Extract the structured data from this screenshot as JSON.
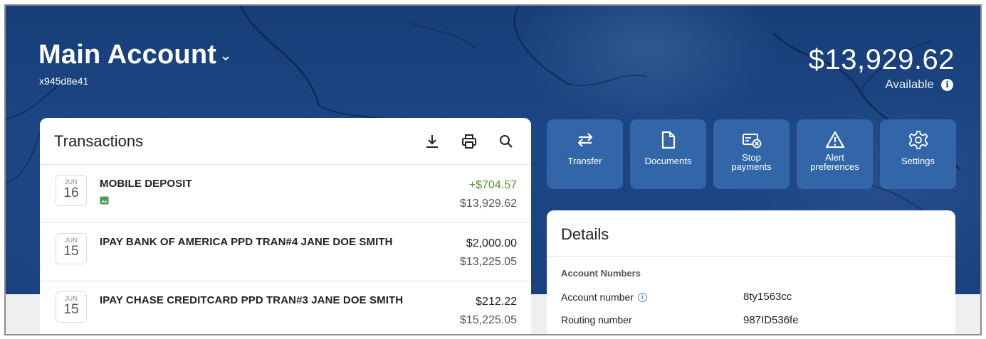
{
  "account": {
    "title": "Main Account",
    "id": "x945d8e41",
    "balance": "$13,929.62",
    "available_label": "Available"
  },
  "transactions": {
    "title": "Transactions",
    "tools": [
      "download-icon",
      "print-icon",
      "search-icon"
    ],
    "rows": [
      {
        "month": "JUN",
        "day": "16",
        "description": "MOBILE DEPOSIT",
        "amount": "+$704.57",
        "balance": "$13,929.62",
        "has_image": true
      },
      {
        "month": "JUN",
        "day": "15",
        "description": "IPAY BANK OF AMERICA PPD TRAN#4 JANE DOE SMITH",
        "amount": "$2,000.00",
        "balance": "$13,225.05",
        "has_image": false
      },
      {
        "month": "JUN",
        "day": "15",
        "description": "IPAY CHASE CREDITCARD PPD TRAN#3  JANE DOE SMITH",
        "amount": "$212.22",
        "balance": "$15,225.05",
        "has_image": false
      }
    ]
  },
  "actions": [
    {
      "label": "Transfer",
      "icon": "transfer-icon"
    },
    {
      "label": "Documents",
      "icon": "document-icon"
    },
    {
      "label": "Stop\npayments",
      "icon": "stop-payment-icon"
    },
    {
      "label": "Alert\npreferences",
      "icon": "alert-icon"
    },
    {
      "label": "Settings",
      "icon": "gear-icon"
    }
  ],
  "details": {
    "title": "Details",
    "section": "Account Numbers",
    "fields": [
      {
        "label": "Account number",
        "value": "8ty1563cc"
      },
      {
        "label": "Routing number",
        "value": "987ID536fe"
      }
    ]
  },
  "colors": {
    "banner": "#1c4684",
    "tile": "#3366a8",
    "positive": "#5a8f3c"
  }
}
